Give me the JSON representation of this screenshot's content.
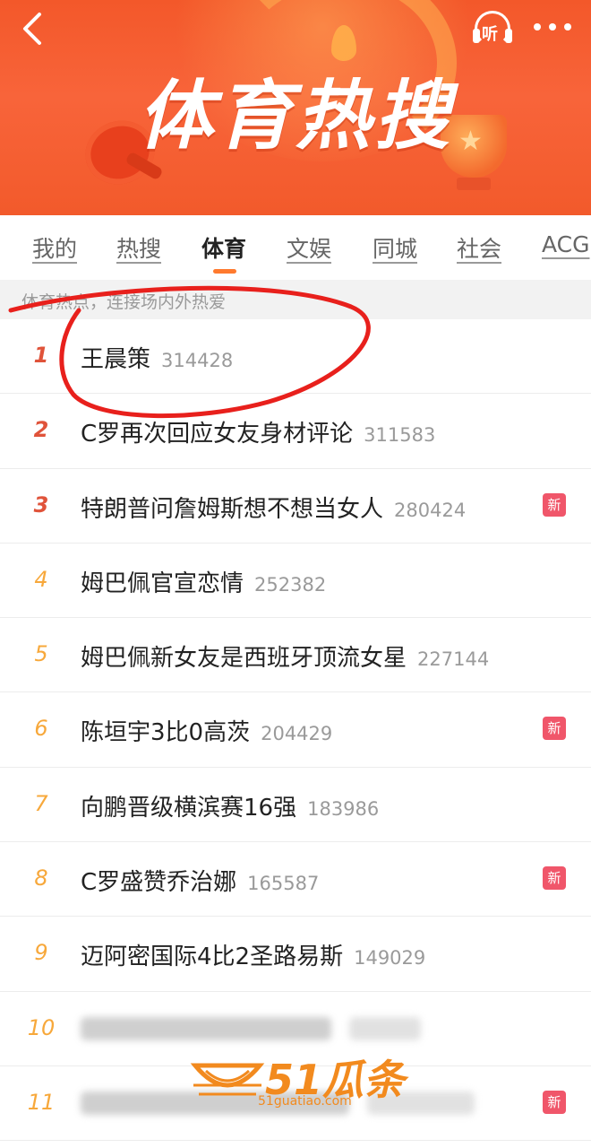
{
  "header": {
    "banner_title": "体育热搜",
    "listen_label": "听"
  },
  "tabs": [
    {
      "label": "我的"
    },
    {
      "label": "热搜"
    },
    {
      "label": "体育"
    },
    {
      "label": "文娱"
    },
    {
      "label": "同城"
    },
    {
      "label": "社会"
    },
    {
      "label": "ACG"
    }
  ],
  "active_tab": "体育",
  "subtitle": "体育热点，连接场内外热爱",
  "list": [
    {
      "rank": "1",
      "title": "王晨策",
      "count": "314428",
      "badge": ""
    },
    {
      "rank": "2",
      "title": "C罗再次回应女友身材评论",
      "count": "311583",
      "badge": ""
    },
    {
      "rank": "3",
      "title": "特朗普问詹姆斯想不想当女人",
      "count": "280424",
      "badge": "新"
    },
    {
      "rank": "4",
      "title": "姆巴佩官宣恋情",
      "count": "252382",
      "badge": ""
    },
    {
      "rank": "5",
      "title": "姆巴佩新女友是西班牙顶流女星",
      "count": "227144",
      "badge": ""
    },
    {
      "rank": "6",
      "title": "陈垣宇3比0高茨",
      "count": "204429",
      "badge": "新"
    },
    {
      "rank": "7",
      "title": "向鹏晋级横滨赛16强",
      "count": "183986",
      "badge": ""
    },
    {
      "rank": "8",
      "title": "C罗盛赞乔治娜",
      "count": "165587",
      "badge": "新"
    },
    {
      "rank": "9",
      "title": "迈阿密国际4比2圣路易斯",
      "count": "149029",
      "badge": ""
    },
    {
      "rank": "10",
      "title": "",
      "count": "",
      "badge": ""
    },
    {
      "rank": "11",
      "title": "",
      "count": "",
      "badge": "新"
    }
  ],
  "watermark": {
    "text": "51瓜条",
    "url": "51guatiao.com"
  },
  "colors": {
    "banner": "#f3582a",
    "rank_top": "#e0533a",
    "rank_other": "#f7a83b",
    "badge_new": "#f0566a",
    "tab_indicator": "#ff7a2e",
    "annotation": "#e8201c",
    "watermark": "#f28a1e"
  }
}
